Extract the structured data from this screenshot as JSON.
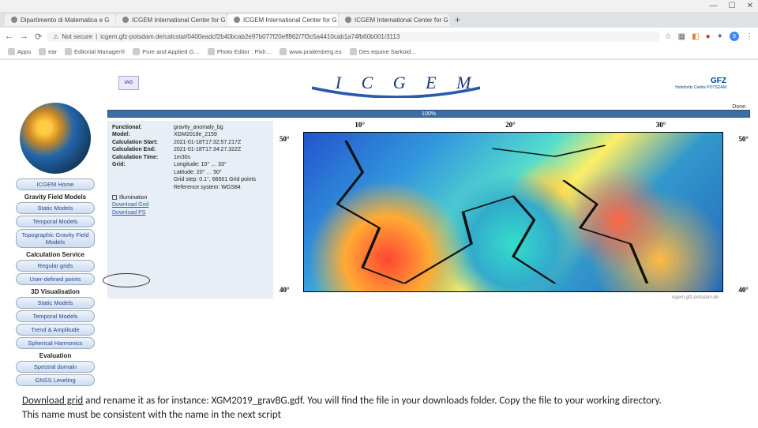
{
  "window_controls": {
    "min": "—",
    "max": "☐",
    "close": "✕"
  },
  "tabs": [
    {
      "label": "Dipartimento di Matematica e G",
      "active": false
    },
    {
      "label": "ICGEM International Center for G",
      "active": false
    },
    {
      "label": "ICGEM International Center for G",
      "active": true
    },
    {
      "label": "ICGEM International Center for G",
      "active": false
    }
  ],
  "newtab": "+",
  "nav": {
    "back": "←",
    "fwd": "→",
    "reload": "⟳"
  },
  "url": {
    "secure_label": "Not secure",
    "text": "icgem.gfz-potsdam.de/calcstat/0400eadcf2b40bcab2e97b077f20eff862/7f3c5a4410cab1a74fb60b001/3113"
  },
  "addr_icons": {
    "star": "☆",
    "grid": "▦",
    "orange": "◧",
    "dot": "●",
    "puzzle": "✦",
    "badge": "9",
    "menu": "⋮"
  },
  "bookmarks": [
    {
      "label": "Apps"
    },
    {
      "label": "ear"
    },
    {
      "label": "Editorial Manager®"
    },
    {
      "label": "Pure and Applied G…"
    },
    {
      "label": "Photo Editor : Pixlr…"
    },
    {
      "label": "www.praitenberg.eu"
    },
    {
      "label": "Des equine Sarkoid…"
    }
  ],
  "banner": {
    "iag": "IAG",
    "title": "I C G E M",
    "gfz": "GFZ",
    "gfz_sub": "Helmholtz Centre\nPOTSDAM"
  },
  "sidebar": {
    "home": "ICGEM Home",
    "h1": "Gravity Field Models",
    "items1": [
      "Static Models",
      "Temporal Models",
      "Topographic Gravity Field Models"
    ],
    "h2": "Calculation Service",
    "items2": [
      "Regular grids",
      "User-defined points"
    ],
    "h3": "3D Visualisation",
    "items3": [
      "Static Models",
      "Temporal Models",
      "Trend & Amplitude",
      "Spherical Harmonics"
    ],
    "h4": "Evaluation",
    "items4": [
      "Spectral domain",
      "GNSS Leveling"
    ]
  },
  "progress": {
    "done": "Done.",
    "pct": "100%"
  },
  "info": {
    "functional_l": "Functional:",
    "functional_v": "gravity_anomaly_bg",
    "model_l": "Model:",
    "model_v": "XGM2019e_2159",
    "start_l": "Calculation Start:",
    "start_v": "2021-01-18T17:32:57.217Z",
    "end_l": "Calculation End:",
    "end_v": "2021-01-18T17:34:27.322Z",
    "time_l": "Calculation Time:",
    "time_v": "1m30s",
    "grid_l": "Grid:",
    "grid_long": "Longitude: 10° … 33°",
    "grid_lat": "Latitude: 20° … 50°",
    "grid_step": "Grid step: 0.1°, 66501 Grid points",
    "grid_ref": "Reference system: WGS84",
    "illum": "Illumination",
    "dl_grid": "Download Grid",
    "dl_ps": "Download PS"
  },
  "map": {
    "top": [
      "10°",
      "20°",
      "30°"
    ],
    "left_top": "50°",
    "right_top": "50°",
    "left_bot": "40°",
    "right_bot": "40°",
    "credit": "icgem.gfz-potsdam.de"
  },
  "caption": {
    "lead": "Download grid",
    "rest1": " and rename it as for instance: XGM2019_gravBG.gdf.  You will find the file in your downloads folder. Copy the file to your working directory.",
    "line2": "This name must be consistent with the name in the next script"
  }
}
